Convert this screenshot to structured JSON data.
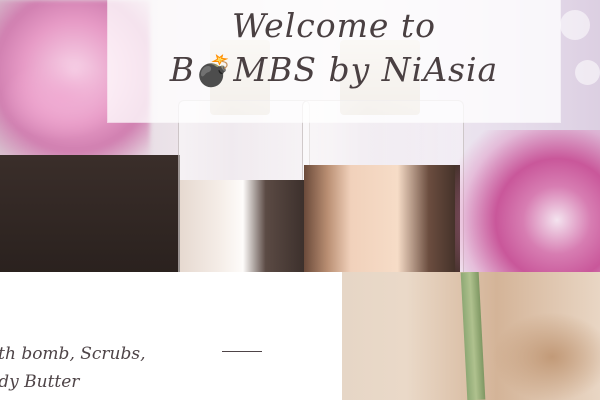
{
  "hero": {
    "title_line1": "Welcome to",
    "title_line2_prefix": "B",
    "title_line2_icon": "💣",
    "title_line2_suffix": "MBS by NiAsia"
  },
  "products": {
    "line1": "ath bomb, Scrubs,",
    "line2": "ody Butter"
  },
  "colors": {
    "title_text": "#4a4042",
    "body_text": "#4e4447",
    "accent_pink": "#c9579a"
  },
  "icons": {
    "bomb": "bomb-icon"
  }
}
